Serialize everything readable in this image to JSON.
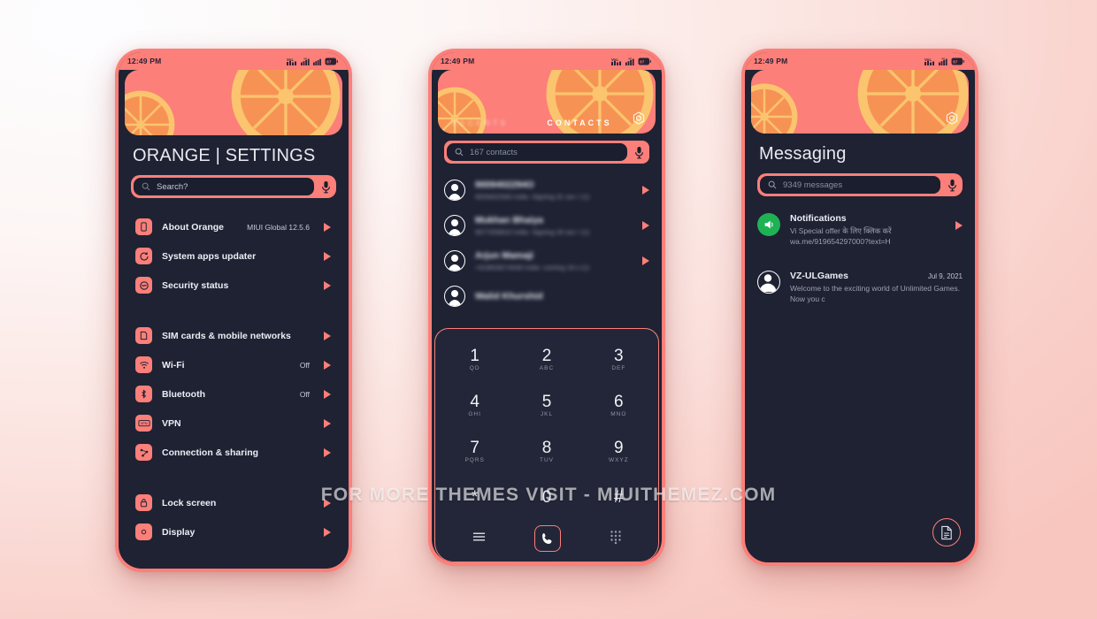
{
  "meta": {
    "watermark": "FOR MORE THEMES VISIT - MIUITHEMEZ.COM",
    "accent": "#fc7f79",
    "surface": "#1e2233",
    "screen_bg": "#1a1e2e",
    "orange_fill": "#f79255",
    "orange_rind": "#fbc46e",
    "page_bg_start": "#fdfdff",
    "page_bg_end": "#f8c6bf"
  },
  "statusbar": {
    "time": "12:49 PM",
    "icons": [
      "volte-icon",
      "signal-icon",
      "signal-icon",
      "battery-icon"
    ]
  },
  "settings": {
    "title": "ORANGE | SETTINGS",
    "search": {
      "placeholder": "Search?",
      "icon": "search-icon",
      "mic": "microphone-icon"
    },
    "groups": [
      {
        "items": [
          {
            "label": "About Orange",
            "value": "MIUI Global 12.5.6",
            "icon": "phone-info-icon"
          },
          {
            "label": "System apps updater",
            "value": "",
            "icon": "refresh-icon"
          },
          {
            "label": "Security status",
            "value": "",
            "icon": "security-icon"
          }
        ]
      },
      {
        "items": [
          {
            "label": "SIM cards & mobile networks",
            "value": "",
            "icon": "sim-card-icon"
          },
          {
            "label": "Wi-Fi",
            "value": "Off",
            "icon": "wifi-icon"
          },
          {
            "label": "Bluetooth",
            "value": "Off",
            "icon": "bluetooth-icon"
          },
          {
            "label": "VPN",
            "value": "",
            "icon": "vpn-icon"
          },
          {
            "label": "Connection & sharing",
            "value": "",
            "icon": "connection-sharing-icon"
          }
        ]
      },
      {
        "items": [
          {
            "label": "Lock screen",
            "value": "",
            "icon": "lock-icon"
          },
          {
            "label": "Display",
            "value": "",
            "icon": "display-icon"
          }
        ]
      }
    ]
  },
  "contacts": {
    "tabs": [
      {
        "label": "RECENTS",
        "active": false,
        "blurred": true
      },
      {
        "label": "CONTACTS",
        "active": true,
        "blurred": false
      }
    ],
    "settings_icon": "gear-icon",
    "search": {
      "placeholder": "167 contacts",
      "icon": "search-icon",
      "mic": "microphone-icon"
    },
    "items": [
      {
        "name": "9009402294O",
        "meta": "9009402940 India  -Signing  31 sec \\ (1)",
        "blurred": true
      },
      {
        "name": "Mukhan Bhaiya",
        "meta": "9977009810 India  -Signing  26 sec \\ (1)",
        "blurred": true
      },
      {
        "name": "Arjun Mamaji",
        "meta": "+918828274040 India  -coming  18 s  (1)",
        "blurred": true
      },
      {
        "name": "Walid Khurshid",
        "meta": "",
        "blurred": true
      }
    ],
    "dialpad": {
      "keys": [
        {
          "num": "1",
          "sub": "QD"
        },
        {
          "num": "2",
          "sub": "ABC"
        },
        {
          "num": "3",
          "sub": "DEF"
        },
        {
          "num": "4",
          "sub": "GHI"
        },
        {
          "num": "5",
          "sub": "JKL"
        },
        {
          "num": "6",
          "sub": "MNO"
        },
        {
          "num": "7",
          "sub": "PQRS"
        },
        {
          "num": "8",
          "sub": "TUV"
        },
        {
          "num": "9",
          "sub": "WXYZ"
        },
        {
          "num": "*",
          "sub": ""
        },
        {
          "num": "0",
          "sub": ""
        },
        {
          "num": "#",
          "sub": ""
        }
      ],
      "bottom": [
        {
          "icon": "menu-icon",
          "label": "Menu"
        },
        {
          "icon": "call-icon",
          "label": "Call"
        },
        {
          "icon": "keypad-icon",
          "label": "Keypad"
        }
      ]
    }
  },
  "messaging": {
    "title": "Messaging",
    "settings_icon": "gear-icon",
    "search": {
      "placeholder": "9349 messages",
      "icon": "search-icon",
      "mic": "microphone-icon"
    },
    "threads": [
      {
        "name": "Notifications",
        "date": "",
        "preview": "Vi Special offer के लिए क्लिक करें wa.me/919654297000?text=H",
        "icon": "speaker-icon",
        "icon_color": "#1fb255",
        "has_arrow": true
      },
      {
        "name": "VZ-ULGames",
        "date": "Jul 9, 2021",
        "preview": "Welcome to the exciting world of Unlimited Games. Now you c",
        "icon": "contact-avatar-icon",
        "icon_color": "transparent",
        "has_arrow": false
      }
    ],
    "compose_icon": "new-message-icon"
  }
}
